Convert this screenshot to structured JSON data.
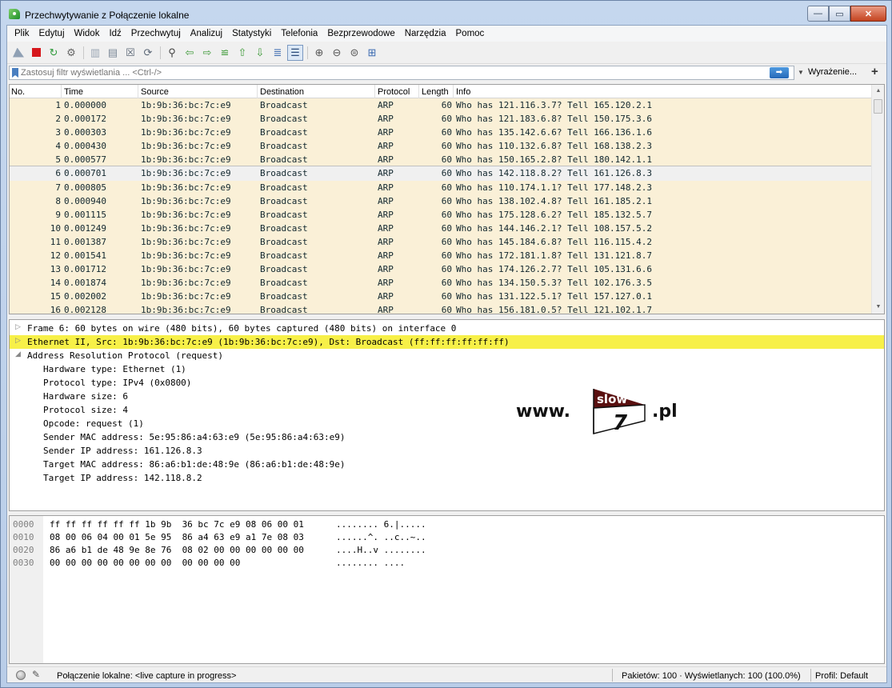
{
  "window": {
    "title": "Przechwytywanie z Połączenie lokalne",
    "minimize_glyph": "—",
    "maximize_glyph": "▭",
    "close_glyph": "✕"
  },
  "menu": [
    "Plik",
    "Edytuj",
    "Widok",
    "Idź",
    "Przechwytuj",
    "Analizuj",
    "Statystyki",
    "Telefonia",
    "Bezprzewodowe",
    "Narzędzia",
    "Pomoc"
  ],
  "toolbar_icons": [
    "shark-fin-start-icon",
    "stop-capture-icon",
    "restart-capture-icon",
    "capture-options-icon",
    "open-file-icon",
    "save-file-icon",
    "close-file-icon",
    "reload-file-icon",
    "find-packet-icon",
    "go-back-icon",
    "go-forward-icon",
    "go-to-packet-icon",
    "go-first-icon",
    "go-last-icon",
    "autoscroll-icon",
    "colorize-icon",
    "zoom-in-icon",
    "zoom-out-icon",
    "zoom-normal-icon",
    "resize-columns-icon"
  ],
  "filter": {
    "placeholder": "Zastosuj filtr wyświetlania ... <Ctrl-/>",
    "apply_glyph": "➡",
    "dropdown_glyph": "▼",
    "expression_label": "Wyrażenie...",
    "plus_label": "+"
  },
  "packet_list": {
    "columns": [
      "No.",
      "Time",
      "Source",
      "Destination",
      "Protocol",
      "Length",
      "Info"
    ],
    "selected_index": 5,
    "rows": [
      {
        "no": "1",
        "time": "0.000000",
        "src": "1b:9b:36:bc:7c:e9",
        "dst": "Broadcast",
        "proto": "ARP",
        "len": "60",
        "info": "Who has 121.116.3.7? Tell 165.120.2.1"
      },
      {
        "no": "2",
        "time": "0.000172",
        "src": "1b:9b:36:bc:7c:e9",
        "dst": "Broadcast",
        "proto": "ARP",
        "len": "60",
        "info": "Who has 121.183.6.8? Tell 150.175.3.6"
      },
      {
        "no": "3",
        "time": "0.000303",
        "src": "1b:9b:36:bc:7c:e9",
        "dst": "Broadcast",
        "proto": "ARP",
        "len": "60",
        "info": "Who has 135.142.6.6? Tell 166.136.1.6"
      },
      {
        "no": "4",
        "time": "0.000430",
        "src": "1b:9b:36:bc:7c:e9",
        "dst": "Broadcast",
        "proto": "ARP",
        "len": "60",
        "info": "Who has 110.132.6.8? Tell 168.138.2.3"
      },
      {
        "no": "5",
        "time": "0.000577",
        "src": "1b:9b:36:bc:7c:e9",
        "dst": "Broadcast",
        "proto": "ARP",
        "len": "60",
        "info": "Who has 150.165.2.8? Tell 180.142.1.1"
      },
      {
        "no": "6",
        "time": "0.000701",
        "src": "1b:9b:36:bc:7c:e9",
        "dst": "Broadcast",
        "proto": "ARP",
        "len": "60",
        "info": "Who has 142.118.8.2? Tell 161.126.8.3"
      },
      {
        "no": "7",
        "time": "0.000805",
        "src": "1b:9b:36:bc:7c:e9",
        "dst": "Broadcast",
        "proto": "ARP",
        "len": "60",
        "info": "Who has 110.174.1.1? Tell 177.148.2.3"
      },
      {
        "no": "8",
        "time": "0.000940",
        "src": "1b:9b:36:bc:7c:e9",
        "dst": "Broadcast",
        "proto": "ARP",
        "len": "60",
        "info": "Who has 138.102.4.8? Tell 161.185.2.1"
      },
      {
        "no": "9",
        "time": "0.001115",
        "src": "1b:9b:36:bc:7c:e9",
        "dst": "Broadcast",
        "proto": "ARP",
        "len": "60",
        "info": "Who has 175.128.6.2? Tell 185.132.5.7"
      },
      {
        "no": "10",
        "time": "0.001249",
        "src": "1b:9b:36:bc:7c:e9",
        "dst": "Broadcast",
        "proto": "ARP",
        "len": "60",
        "info": "Who has 144.146.2.1? Tell 108.157.5.2"
      },
      {
        "no": "11",
        "time": "0.001387",
        "src": "1b:9b:36:bc:7c:e9",
        "dst": "Broadcast",
        "proto": "ARP",
        "len": "60",
        "info": "Who has 145.184.6.8? Tell 116.115.4.2"
      },
      {
        "no": "12",
        "time": "0.001541",
        "src": "1b:9b:36:bc:7c:e9",
        "dst": "Broadcast",
        "proto": "ARP",
        "len": "60",
        "info": "Who has 172.181.1.8? Tell 131.121.8.7"
      },
      {
        "no": "13",
        "time": "0.001712",
        "src": "1b:9b:36:bc:7c:e9",
        "dst": "Broadcast",
        "proto": "ARP",
        "len": "60",
        "info": "Who has 174.126.2.7? Tell 105.131.6.6"
      },
      {
        "no": "14",
        "time": "0.001874",
        "src": "1b:9b:36:bc:7c:e9",
        "dst": "Broadcast",
        "proto": "ARP",
        "len": "60",
        "info": "Who has 134.150.5.3? Tell 102.176.3.5"
      },
      {
        "no": "15",
        "time": "0.002002",
        "src": "1b:9b:36:bc:7c:e9",
        "dst": "Broadcast",
        "proto": "ARP",
        "len": "60",
        "info": "Who has 131.122.5.1? Tell 157.127.0.1"
      },
      {
        "no": "16",
        "time": "0.002128",
        "src": "1b:9b:36:bc:7c:e9",
        "dst": "Broadcast",
        "proto": "ARP",
        "len": "60",
        "info": "Who has 156.181.0.5? Tell 121.102.1.7"
      }
    ]
  },
  "details": [
    {
      "tri": "▷",
      "text": "Frame 6: 60 bytes on wire (480 bits), 60 bytes captured (480 bits) on interface 0",
      "child": false,
      "hl": false
    },
    {
      "tri": "▷",
      "text": "Ethernet II, Src: 1b:9b:36:bc:7c:e9 (1b:9b:36:bc:7c:e9), Dst: Broadcast (ff:ff:ff:ff:ff:ff)",
      "child": false,
      "hl": true
    },
    {
      "tri": "◢",
      "text": "Address Resolution Protocol (request)",
      "child": false,
      "hl": false
    },
    {
      "tri": "",
      "text": "Hardware type: Ethernet (1)",
      "child": true,
      "hl": false
    },
    {
      "tri": "",
      "text": "Protocol type: IPv4 (0x0800)",
      "child": true,
      "hl": false
    },
    {
      "tri": "",
      "text": "Hardware size: 6",
      "child": true,
      "hl": false
    },
    {
      "tri": "",
      "text": "Protocol size: 4",
      "child": true,
      "hl": false
    },
    {
      "tri": "",
      "text": "Opcode: request (1)",
      "child": true,
      "hl": false
    },
    {
      "tri": "",
      "text": "Sender MAC address: 5e:95:86:a4:63:e9 (5e:95:86:a4:63:e9)",
      "child": true,
      "hl": false
    },
    {
      "tri": "",
      "text": "Sender IP address: 161.126.8.3",
      "child": true,
      "hl": false
    },
    {
      "tri": "",
      "text": "Target MAC address: 86:a6:b1:de:48:9e (86:a6:b1:de:48:9e)",
      "child": true,
      "hl": false
    },
    {
      "tri": "",
      "text": "Target IP address: 142.118.8.2",
      "child": true,
      "hl": false
    }
  ],
  "logo": {
    "www": "www.",
    "top": "slow",
    "digit": "7",
    "pl": ".pl",
    "dark_color": "#5a1010"
  },
  "bytes": [
    {
      "off": "0000",
      "hex": "ff ff ff ff ff ff 1b 9b  36 bc 7c e9 08 06 00 01",
      "ascii": "........ 6.|....."
    },
    {
      "off": "0010",
      "hex": "08 00 06 04 00 01 5e 95  86 a4 63 e9 a1 7e 08 03",
      "ascii": "......^. ..c..~.."
    },
    {
      "off": "0020",
      "hex": "86 a6 b1 de 48 9e 8e 76  08 02 00 00 00 00 00 00",
      "ascii": "....H..v ........"
    },
    {
      "off": "0030",
      "hex": "00 00 00 00 00 00 00 00  00 00 00 00",
      "ascii": "........ ...."
    }
  ],
  "status": {
    "interface": "Połączenie lokalne: <live capture in progress>",
    "packets": "Pakietów: 100 · Wyświetlanych: 100 (100.0%)",
    "profile": "Profil: Default",
    "edit_glyph": "✎"
  },
  "colors": {
    "row_bg": "#faf0d7",
    "highlight": "#f7f048",
    "stop_red": "#d6171c"
  }
}
